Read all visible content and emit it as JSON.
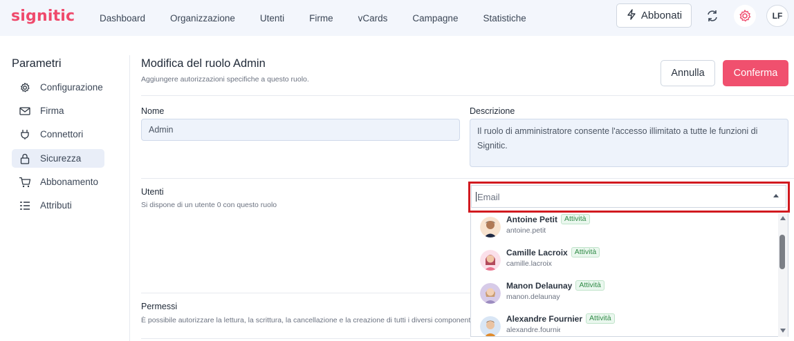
{
  "app": {
    "logo": "signitic"
  },
  "nav": [
    "Dashboard",
    "Organizzazione",
    "Utenti",
    "Firme",
    "vCards",
    "Campagne",
    "Statistiche"
  ],
  "header": {
    "subscribe_label": "Abbonati",
    "avatar_initials": "LF",
    "accent_color": "#ef4a6c"
  },
  "sidebar": {
    "title": "Parametri",
    "items": [
      {
        "label": "Configurazione",
        "icon": "gear-icon"
      },
      {
        "label": "Firma",
        "icon": "mail-icon"
      },
      {
        "label": "Connettori",
        "icon": "plug-icon"
      },
      {
        "label": "Sicurezza",
        "icon": "lock-icon",
        "active": true
      },
      {
        "label": "Abbonamento",
        "icon": "cart-icon"
      },
      {
        "label": "Attributi",
        "icon": "list-icon"
      }
    ]
  },
  "main": {
    "title": "Modifica del ruolo Admin",
    "subtitle": "Aggiungere autorizzazioni specifiche a questo ruolo.",
    "cancel_label": "Annulla",
    "confirm_label": "Conferma",
    "name_label": "Nome",
    "name_value": "Admin",
    "description_label": "Descrizione",
    "description_value": "Il ruolo di amministratore consente l'accesso illimitato a tutte le funzioni di Signitic.",
    "users_label": "Utenti",
    "users_sub": "Si dispone di un utente 0 con questo ruolo",
    "email_placeholder": "Email",
    "permissions_label": "Permessi",
    "permissions_sub": "È possibile autorizzare la lettura, la scrittura, la cancellazione e la creazione di tutti i diversi component"
  },
  "users": [
    {
      "name": "Antoine Petit",
      "email": "antoine.petit",
      "status": "Attività"
    },
    {
      "name": "Camille Lacroix",
      "email": "camille.lacroix",
      "status": "Attività"
    },
    {
      "name": "Manon Delaunay",
      "email": "manon.delaunay",
      "status": "Attività"
    },
    {
      "name": "Alexandre Fournier",
      "email": "alexandre.fournier",
      "status": "Attività"
    }
  ]
}
